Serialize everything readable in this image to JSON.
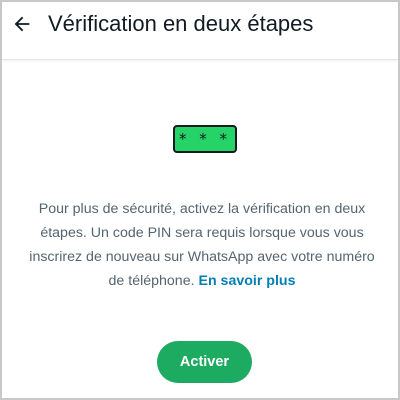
{
  "header": {
    "back_icon": "arrow-left-icon",
    "title": "Vérification en deux étapes"
  },
  "main": {
    "pin_badge_text": "* * *",
    "description": "Pour plus de sécurité, activez la vérification en deux étapes. Un code PIN sera requis lorsque vous vous inscrirez de nouveau sur WhatsApp avec votre numéro de téléphone.",
    "learn_more_label": "En savoir plus",
    "activate_button_label": "Activer"
  },
  "colors": {
    "accent_green": "#1daa61",
    "pin_badge_green": "#25d366",
    "link_blue": "#027eb5",
    "body_text": "#54656f",
    "title_text": "#111b21"
  }
}
